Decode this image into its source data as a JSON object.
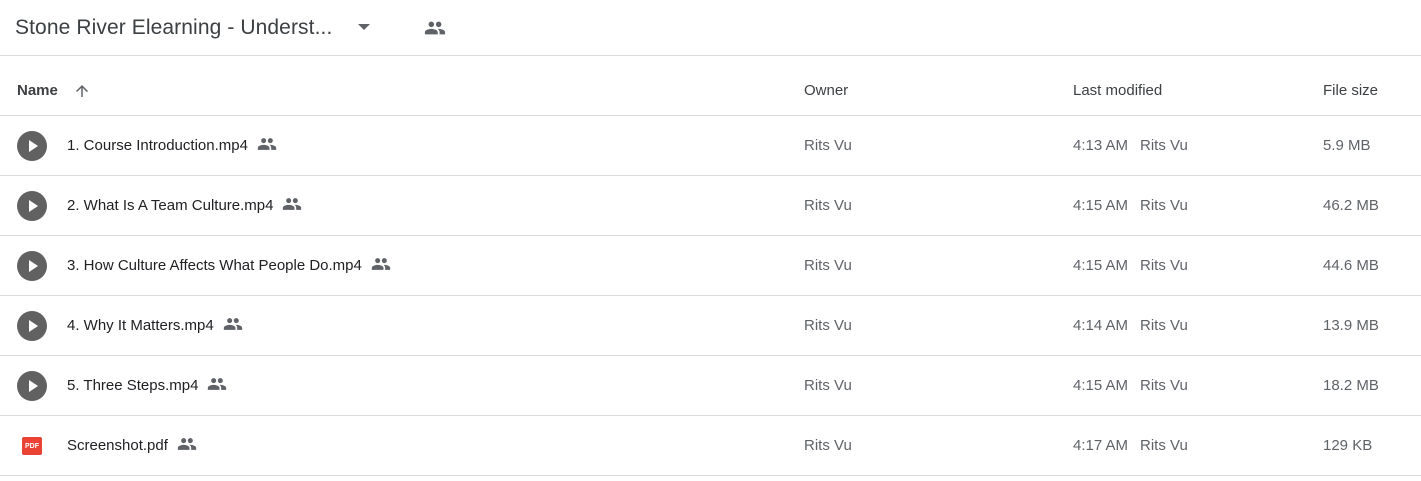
{
  "header": {
    "folder_title": "Stone River Elearning - Underst...",
    "icons": [
      "dropdown-caret-icon",
      "shared-people-icon"
    ]
  },
  "columns": {
    "name": "Name",
    "owner": "Owner",
    "last_modified": "Last modified",
    "file_size": "File size",
    "sort_icon": "arrow-up-icon"
  },
  "files": [
    {
      "name": "1. Course Introduction.mp4",
      "type": "video",
      "icon": "play-circle-icon",
      "owner": "Rits Vu",
      "modified_time": "4:13 AM",
      "modified_by": "Rits Vu",
      "size": "5.9 MB"
    },
    {
      "name": "2. What Is A Team Culture.mp4",
      "type": "video",
      "icon": "play-circle-icon",
      "owner": "Rits Vu",
      "modified_time": "4:15 AM",
      "modified_by": "Rits Vu",
      "size": "46.2 MB"
    },
    {
      "name": "3. How Culture Affects What People Do.mp4",
      "type": "video",
      "icon": "play-circle-icon",
      "owner": "Rits Vu",
      "modified_time": "4:15 AM",
      "modified_by": "Rits Vu",
      "size": "44.6 MB"
    },
    {
      "name": "4. Why It Matters.mp4",
      "type": "video",
      "icon": "play-circle-icon",
      "owner": "Rits Vu",
      "modified_time": "4:14 AM",
      "modified_by": "Rits Vu",
      "size": "13.9 MB"
    },
    {
      "name": "5. Three Steps.mp4",
      "type": "video",
      "icon": "play-circle-icon",
      "owner": "Rits Vu",
      "modified_time": "4:15 AM",
      "modified_by": "Rits Vu",
      "size": "18.2 MB"
    },
    {
      "name": "Screenshot.pdf",
      "type": "pdf",
      "icon": "pdf-icon",
      "badge": "PDF",
      "owner": "Rits Vu",
      "modified_time": "4:17 AM",
      "modified_by": "Rits Vu",
      "size": "129 KB"
    }
  ],
  "colors": {
    "pdf": "#ea4335",
    "video_icon": "#616161",
    "divider": "#dadce0"
  }
}
